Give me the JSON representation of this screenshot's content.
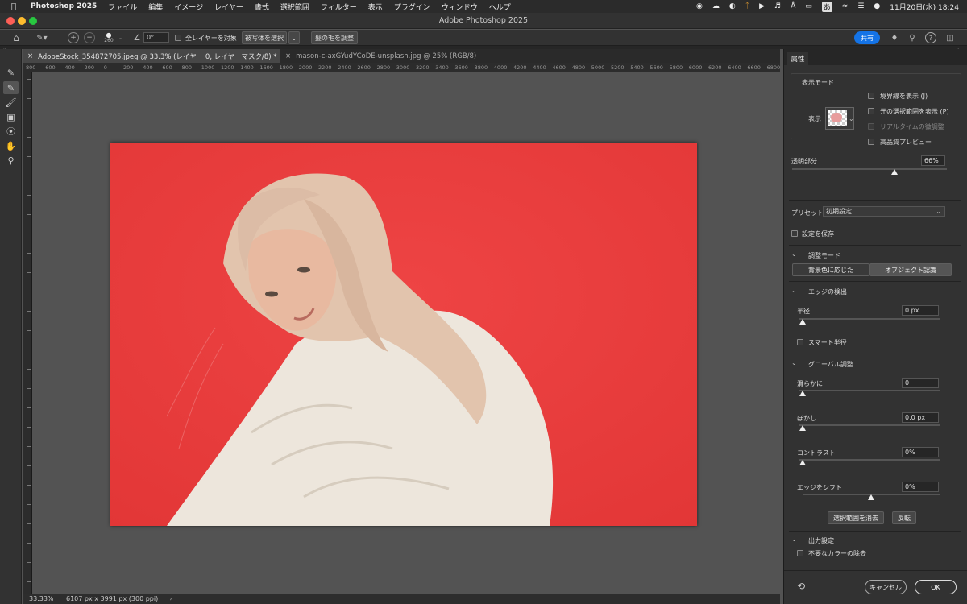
{
  "menubar": {
    "app_name": "Photoshop 2025",
    "items": [
      "ファイル",
      "編集",
      "イメージ",
      "レイヤー",
      "書式",
      "選択範囲",
      "フィルター",
      "表示",
      "プラグイン",
      "ウィンドウ",
      "ヘルプ"
    ],
    "ime": "あ",
    "datetime": "11月20日(水)  18:24"
  },
  "window": {
    "title": "Adobe Photoshop 2025"
  },
  "options": {
    "brush_size": "260",
    "angle": "0°",
    "all_layers_label": "全レイヤーを対象",
    "select_subject_label": "被写体を選択",
    "refine_hair_label": "髪の毛を調整",
    "share_label": "共有"
  },
  "tabs": [
    {
      "label": "AdobeStock_354872705.jpeg @ 33.3% (レイヤー 0, レイヤーマスク/8) *",
      "active": true
    },
    {
      "label": "mason-c-axGYudYCoDE-unsplash.jpg @ 25% (RGB/8)",
      "active": false
    }
  ],
  "ruler": {
    "h_labels": [
      "800",
      "600",
      "400",
      "200",
      "0",
      "200",
      "400",
      "600",
      "800",
      "1000",
      "1200",
      "1400",
      "1600",
      "1800",
      "2000",
      "2200",
      "2400",
      "2600",
      "2800",
      "3000",
      "3200",
      "3400",
      "3600",
      "3800",
      "4000",
      "4200",
      "4400",
      "4600",
      "4800",
      "5000",
      "5200",
      "5400",
      "5600",
      "5800",
      "6000",
      "6200",
      "6400",
      "6600",
      "6800"
    ]
  },
  "status": {
    "zoom": "33.33%",
    "doc_info": "6107 px x 3991 px (300 ppi)"
  },
  "panel": {
    "tab": "属性",
    "view_mode_section": "表示モード",
    "view_label": "表示",
    "show_edge": "境界線を表示 (J)",
    "show_original": "元の選択範囲を表示 (P)",
    "realtime": "リアルタイムの微調整",
    "hq_preview": "高品質プレビュー",
    "transparency_label": "透明部分",
    "transparency_value": "66%",
    "transparency_level": 0.66,
    "preset_label": "プリセット",
    "preset_value": "初期設定",
    "save_settings": "設定を保存",
    "adjust_mode": "調整モード",
    "mode_color_aware": "背景色に応じた",
    "mode_object_aware": "オブジェクト認識",
    "edge_detection": "エッジの検出",
    "radius_label": "半径",
    "radius_value": "0 px",
    "smart_radius": "スマート半径",
    "global_refine": "グローバル調整",
    "smooth_label": "滑らかに",
    "smooth_value": "0",
    "feather_label": "ぼかし",
    "feather_value": "0.0 px",
    "contrast_label": "コントラスト",
    "contrast_value": "0%",
    "shift_edge_label": "エッジをシフト",
    "shift_edge_value": "0%",
    "clear_selection": "選択範囲を消去",
    "invert": "反転",
    "output_settings": "出力設定",
    "decontaminate": "不要なカラーの除去",
    "cancel": "キャンセル",
    "ok": "OK"
  },
  "colors": {
    "overlay_red": "#ea3b3b",
    "share_blue": "#1473e6",
    "ui_dark": "#323232"
  }
}
